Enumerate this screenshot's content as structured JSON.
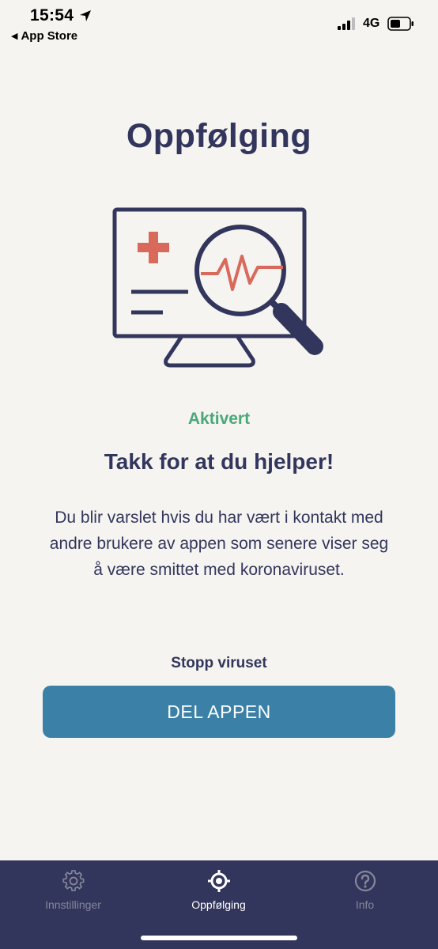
{
  "status_bar": {
    "time": "15:54",
    "back_label": "App Store",
    "network": "4G"
  },
  "main": {
    "title": "Oppfølging",
    "status": "Aktivert",
    "headline": "Takk for at du hjelper!",
    "body": "Du blir varslet hvis du har vært i kontakt med andre brukere av appen som senere viser seg å være smittet med koronaviruset.",
    "share_label": "Stopp viruset",
    "share_button": "DEL APPEN"
  },
  "tabs": [
    {
      "label": "Innstillinger",
      "icon": "gear-icon",
      "active": false
    },
    {
      "label": "Oppfølging",
      "icon": "target-icon",
      "active": true
    },
    {
      "label": "Info",
      "icon": "question-icon",
      "active": false
    }
  ],
  "colors": {
    "background": "#f5f4f0",
    "primary_text": "#33365c",
    "accent_green": "#4aa879",
    "button": "#3a80a7",
    "tab_bar": "#33365c",
    "illustration_red": "#d9695a"
  }
}
